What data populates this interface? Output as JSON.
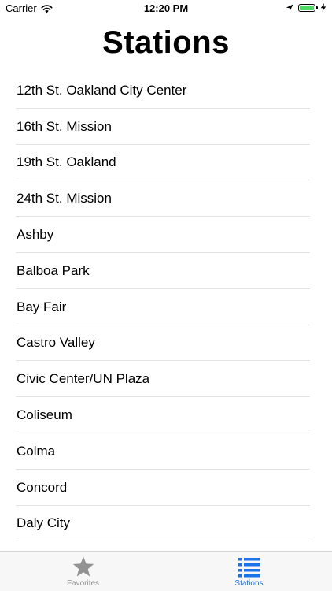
{
  "status_bar": {
    "carrier": "Carrier",
    "time": "12:20 PM",
    "battery_color": "#4cd964"
  },
  "page": {
    "title": "Stations"
  },
  "stations": [
    "12th St. Oakland City Center",
    "16th St. Mission",
    "19th St. Oakland",
    "24th St. Mission",
    "Ashby",
    "Balboa Park",
    "Bay Fair",
    "Castro Valley",
    "Civic Center/UN Plaza",
    "Coliseum",
    "Colma",
    "Concord",
    "Daly City"
  ],
  "tab_bar": {
    "tabs": [
      {
        "label": "Favorites",
        "icon": "star-icon",
        "selected": false,
        "color": "#929292"
      },
      {
        "label": "Stations",
        "icon": "list-icon",
        "selected": true,
        "color": "#1a73e8"
      }
    ]
  }
}
